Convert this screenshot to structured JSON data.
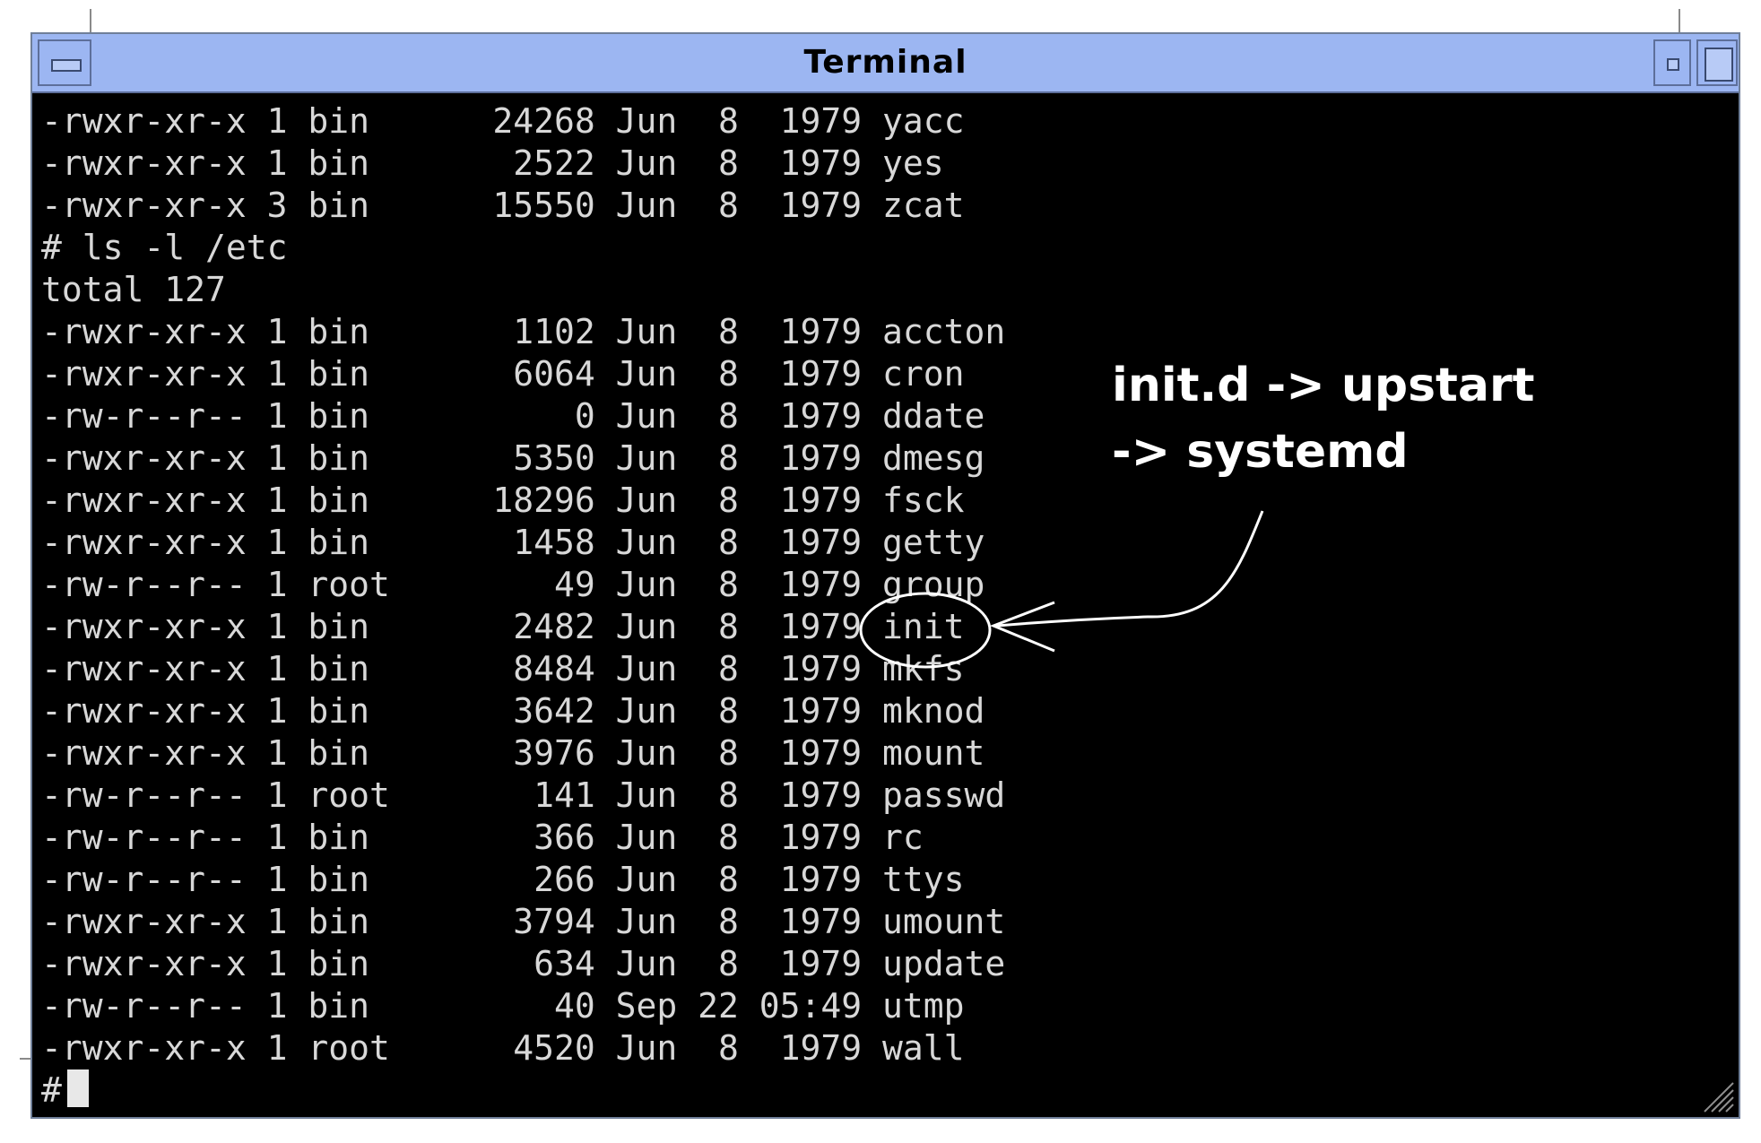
{
  "window": {
    "title": "Terminal"
  },
  "terminal": {
    "lines": [
      "-rwxr-xr-x 1 bin      24268 Jun  8  1979 yacc",
      "-rwxr-xr-x 1 bin       2522 Jun  8  1979 yes",
      "-rwxr-xr-x 3 bin      15550 Jun  8  1979 zcat",
      "# ls -l /etc",
      "total 127",
      "-rwxr-xr-x 1 bin       1102 Jun  8  1979 accton",
      "-rwxr-xr-x 1 bin       6064 Jun  8  1979 cron",
      "-rw-r--r-- 1 bin          0 Jun  8  1979 ddate",
      "-rwxr-xr-x 1 bin       5350 Jun  8  1979 dmesg",
      "-rwxr-xr-x 1 bin      18296 Jun  8  1979 fsck",
      "-rwxr-xr-x 1 bin       1458 Jun  8  1979 getty",
      "-rw-r--r-- 1 root        49 Jun  8  1979 group",
      "-rwxr-xr-x 1 bin       2482 Jun  8  1979 init",
      "-rwxr-xr-x 1 bin       8484 Jun  8  1979 mkfs",
      "-rwxr-xr-x 1 bin       3642 Jun  8  1979 mknod",
      "-rwxr-xr-x 1 bin       3976 Jun  8  1979 mount",
      "-rw-r--r-- 1 root       141 Jun  8  1979 passwd",
      "-rw-r--r-- 1 bin        366 Jun  8  1979 rc",
      "-rw-r--r-- 1 bin        266 Jun  8  1979 ttys",
      "-rwxr-xr-x 1 bin       3794 Jun  8  1979 umount",
      "-rwxr-xr-x 1 bin        634 Jun  8  1979 update",
      "-rw-r--r-- 1 bin         40 Sep 22 05:49 utmp",
      "-rwxr-xr-x 1 root      4520 Jun  8  1979 wall"
    ],
    "prompt": "#"
  },
  "annotation": {
    "line1": "init.d -> upstart",
    "line2": "-> systemd"
  },
  "colors": {
    "titlebar": "#9cb6f2",
    "terminal_bg": "#000000",
    "terminal_fg": "#d8d8d8"
  }
}
